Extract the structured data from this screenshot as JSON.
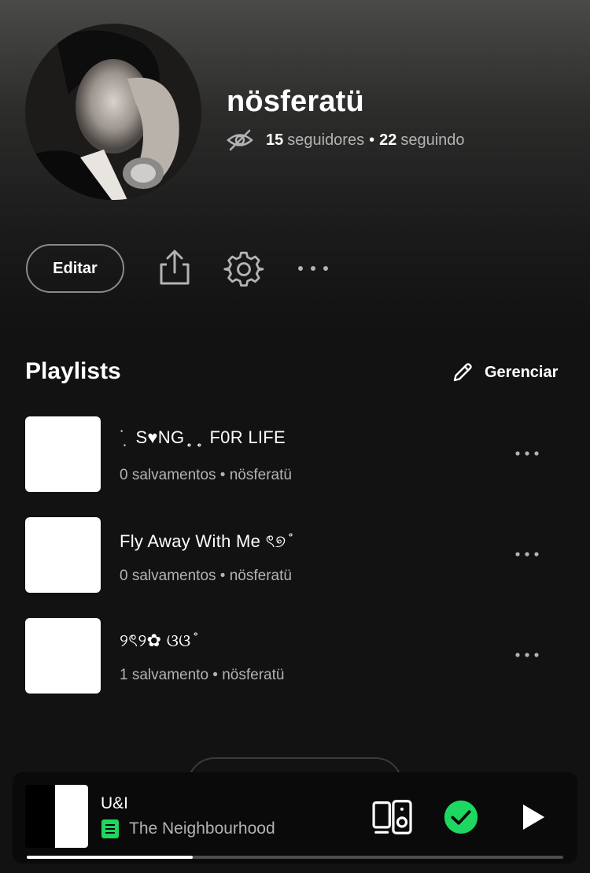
{
  "profile": {
    "name": "nösferatü",
    "followers_count": "15",
    "followers_label": "seguidores",
    "following_count": "22",
    "following_label": "seguindo",
    "separator": "•"
  },
  "actions": {
    "edit_label": "Editar"
  },
  "playlists": {
    "section_title": "Playlists",
    "manage_label": "Gerenciar",
    "items": [
      {
        "title": "˙ ̣   S♥NG ̥ ̣ ̥ ̣  F0R LIFE",
        "subtitle": "0 salvamentos • nösferatü"
      },
      {
        "title": "Fly  Away  With  Me   ৎ୭ ̊",
        "subtitle": "0 salvamentos • nösferatü"
      },
      {
        "title": "୨ৎ୨✿ ଓଓ ̊",
        "subtitle": "1 salvamento • nösferatü"
      }
    ]
  },
  "now_playing": {
    "title": "U&I",
    "artist": "The Neighbourhood",
    "progress": 0.31,
    "accent_color": "#1ed760"
  },
  "colors": {
    "background": "#121212",
    "secondary_text": "#b3b3b3",
    "accent": "#1ed760"
  }
}
